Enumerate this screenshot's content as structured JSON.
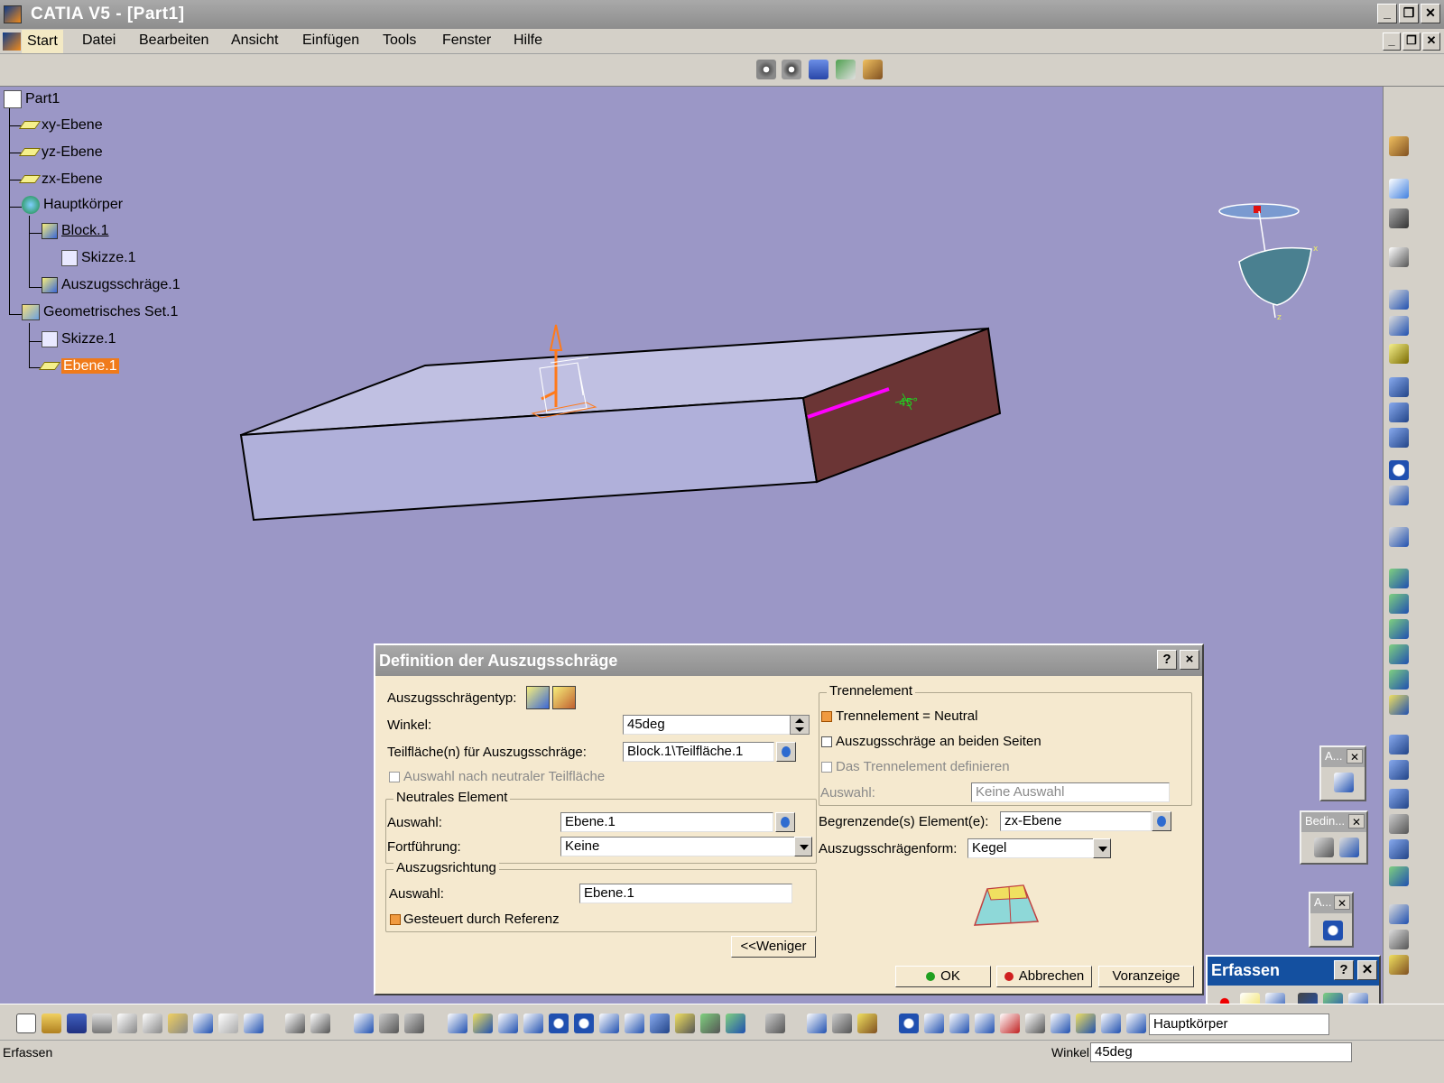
{
  "window": {
    "title": "CATIA V5 - [Part1]"
  },
  "menu": {
    "items": [
      {
        "label": "Start"
      },
      {
        "label": "Datei"
      },
      {
        "label": "Bearbeiten"
      },
      {
        "label": "Ansicht"
      },
      {
        "label": "Einfügen"
      },
      {
        "label": "Tools"
      },
      {
        "label": "Fenster"
      },
      {
        "label": "Hilfe"
      }
    ]
  },
  "tree": {
    "root": "Part1",
    "nodes": [
      {
        "label": "xy-Ebene",
        "icon": "plane-icon"
      },
      {
        "label": "yz-Ebene",
        "icon": "plane-icon"
      },
      {
        "label": "zx-Ebene",
        "icon": "plane-icon"
      },
      {
        "label": "Hauptkörper",
        "icon": "body-icon"
      },
      {
        "label": "Block.1",
        "icon": "pad-icon"
      },
      {
        "label": "Skizze.1",
        "icon": "sketch-icon"
      },
      {
        "label": "Auszugsschräge.1",
        "icon": "draft-icon"
      },
      {
        "label": "Geometrisches Set.1",
        "icon": "geometrical-set-icon"
      },
      {
        "label": "Skizze.1",
        "icon": "sketch-icon"
      },
      {
        "label": "Ebene.1",
        "icon": "plane-icon"
      }
    ]
  },
  "viewport": {
    "angle_annotation": "45°"
  },
  "dialog": {
    "title": "Definition der Auszugsschräge",
    "help": "?",
    "close": "×",
    "draft_type_label": "Auszugsschrägentyp:",
    "angle_label": "Winkel:",
    "angle_value": "45deg",
    "faces_label": "Teilfläche(n) für Auszugsschräge:",
    "faces_value": "Block.1\\Teilfläche.1",
    "select_by_neutral": "Auswahl nach neutraler Teilfläche",
    "neutral": {
      "title": "Neutrales Element",
      "selection_label": "Auswahl:",
      "selection_value": "Ebene.1",
      "propagation_label": "Fortführung:",
      "propagation_value": "Keine"
    },
    "pulling": {
      "title": "Auszugsrichtung",
      "selection_label": "Auswahl:",
      "selection_value": "Ebene.1",
      "controlled_label": "Gesteuert durch Referenz"
    },
    "parting": {
      "title": "Trennelement",
      "neutral_label": "Trennelement = Neutral",
      "both_sides_label": "Auszugsschräge an beiden Seiten",
      "define_label": "Das Trennelement definieren",
      "selection_label": "Auswahl:",
      "selection_value": "Keine Auswahl"
    },
    "limiting_label": "Begrenzende(s) Element(e):",
    "limiting_value": "zx-Ebene",
    "draft_form_label": "Auszugsschrägenform:",
    "draft_form_value": "Kegel",
    "less_button": "<<Weniger",
    "ok_button": "OK",
    "cancel_button": "Abbrechen",
    "preview_button": "Voranzeige"
  },
  "floating": {
    "annotations_title": "A...",
    "constraints_title": "Bedin...",
    "third_title": "A...",
    "erfassen_title": "Erfassen"
  },
  "bottom": {
    "current_body": "Hauptkörper"
  },
  "status": {
    "text": "Erfassen",
    "value_label": "Winkel",
    "value": "45deg"
  },
  "colors": {
    "viewport": "#9b97c6",
    "dialog": "#f5e9cf",
    "selection": "#f07a1a",
    "draft_face": "#6b3535"
  }
}
